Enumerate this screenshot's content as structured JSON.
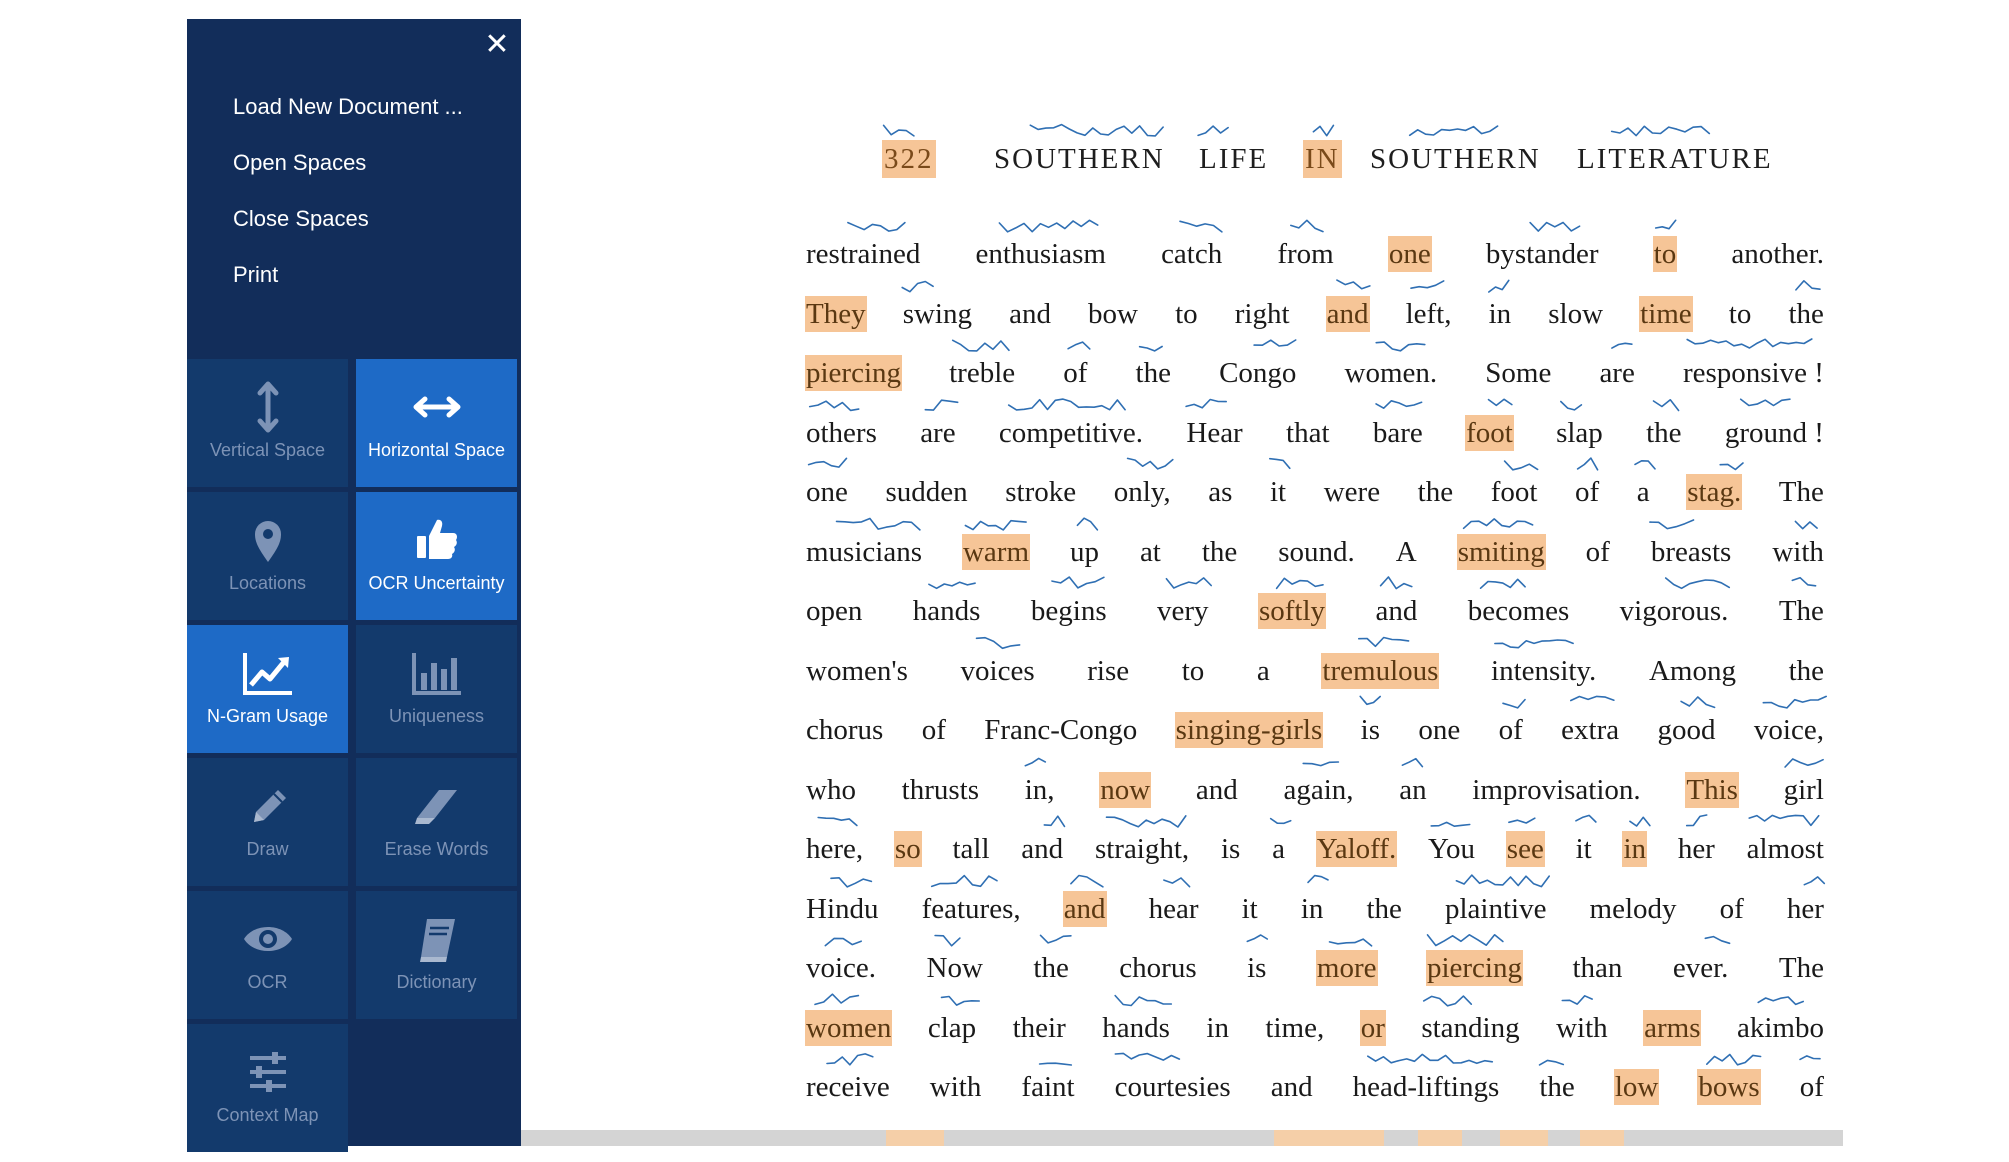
{
  "sidebar": {
    "menu": [
      "Load New Document ...",
      "Open Spaces",
      "Close Spaces",
      "Print"
    ],
    "tools": [
      {
        "label": "Vertical Space",
        "icon": "vertical-arrows-icon",
        "active": false
      },
      {
        "label": "Horizontal Space",
        "icon": "horizontal-arrows-icon",
        "active": true
      },
      {
        "label": "Locations",
        "icon": "map-pin-icon",
        "active": false
      },
      {
        "label": "OCR Uncertainty",
        "icon": "thumbs-up-icon",
        "active": true
      },
      {
        "label": "N-Gram Usage",
        "icon": "line-chart-icon",
        "active": true
      },
      {
        "label": "Uniqueness",
        "icon": "bar-chart-icon",
        "active": false
      },
      {
        "label": "Draw",
        "icon": "pencil-icon",
        "active": false
      },
      {
        "label": "Erase Words",
        "icon": "eraser-icon",
        "active": false
      },
      {
        "label": "OCR",
        "icon": "eye-icon",
        "active": false
      },
      {
        "label": "Dictionary",
        "icon": "book-icon",
        "active": false
      },
      {
        "label": "Context Map",
        "icon": "sliders-icon",
        "active": false
      }
    ]
  },
  "document": {
    "header": [
      {
        "text": "322",
        "hl": true
      },
      {
        "text": "SOUTHERN",
        "hl": false
      },
      {
        "text": "LIFE",
        "hl": false
      },
      {
        "text": "IN",
        "hl": true
      },
      {
        "text": "SOUTHERN",
        "hl": false
      },
      {
        "text": "LITERATURE",
        "hl": false
      }
    ],
    "lines": [
      [
        "restrained",
        "enthusiasm",
        "catch",
        "from",
        "*one",
        "bystander",
        "*to",
        "another."
      ],
      [
        "*They",
        "swing",
        "and",
        "bow",
        "to",
        "right",
        "*and",
        "left,",
        "in",
        "slow",
        "*time",
        "to",
        "the"
      ],
      [
        "*piercing",
        "treble",
        "of",
        "the",
        "Congo",
        "women.",
        "Some",
        "are",
        "responsive !"
      ],
      [
        "others",
        "are",
        "competitive.",
        "Hear",
        "that",
        "bare",
        "*foot",
        "slap",
        "the",
        "ground !"
      ],
      [
        "one",
        "sudden",
        "stroke",
        "only,",
        "as",
        "it",
        "were",
        "the",
        "foot",
        "of",
        "a",
        "*stag.",
        "The"
      ],
      [
        "musicians",
        "*warm",
        "up",
        "at",
        "the",
        "sound.",
        "A",
        "*smiting",
        "of",
        "breasts",
        "with"
      ],
      [
        "open",
        "hands",
        "begins",
        "very",
        "*softly",
        "and",
        "becomes",
        "vigorous.",
        "The"
      ],
      [
        "women's",
        "voices",
        "rise",
        "to",
        "a",
        "*tremulous",
        "intensity.",
        "Among",
        "the"
      ],
      [
        "chorus",
        "of",
        "Franc-Congo",
        "*singing-girls",
        "is",
        "one",
        "of",
        "extra",
        "good",
        "voice,"
      ],
      [
        "who",
        "thrusts",
        "in,",
        "*now",
        "and",
        "again,",
        "an",
        "improvisation.",
        "*This",
        "girl"
      ],
      [
        "here,",
        "*so",
        "tall",
        "and",
        "straight,",
        "is",
        "a",
        "*Yaloff.",
        "You",
        "*see",
        "it",
        "*in",
        "her",
        "almost"
      ],
      [
        "Hindu",
        "features,",
        "*and",
        "hear",
        "it",
        "in",
        "the",
        "plaintive",
        "melody",
        "of",
        "her"
      ],
      [
        "voice.",
        "Now",
        "the",
        "chorus",
        "is",
        "*more",
        "*piercing",
        "than",
        "ever.",
        "The"
      ],
      [
        "*women",
        "clap",
        "their",
        "hands",
        "in",
        "time,",
        "*or",
        "standing",
        "with",
        "*arms",
        "akimbo"
      ],
      [
        "receive",
        "with",
        "faint",
        "courtesies",
        "and",
        "head-liftings",
        "the",
        "*low",
        "*bows",
        "of"
      ]
    ]
  }
}
